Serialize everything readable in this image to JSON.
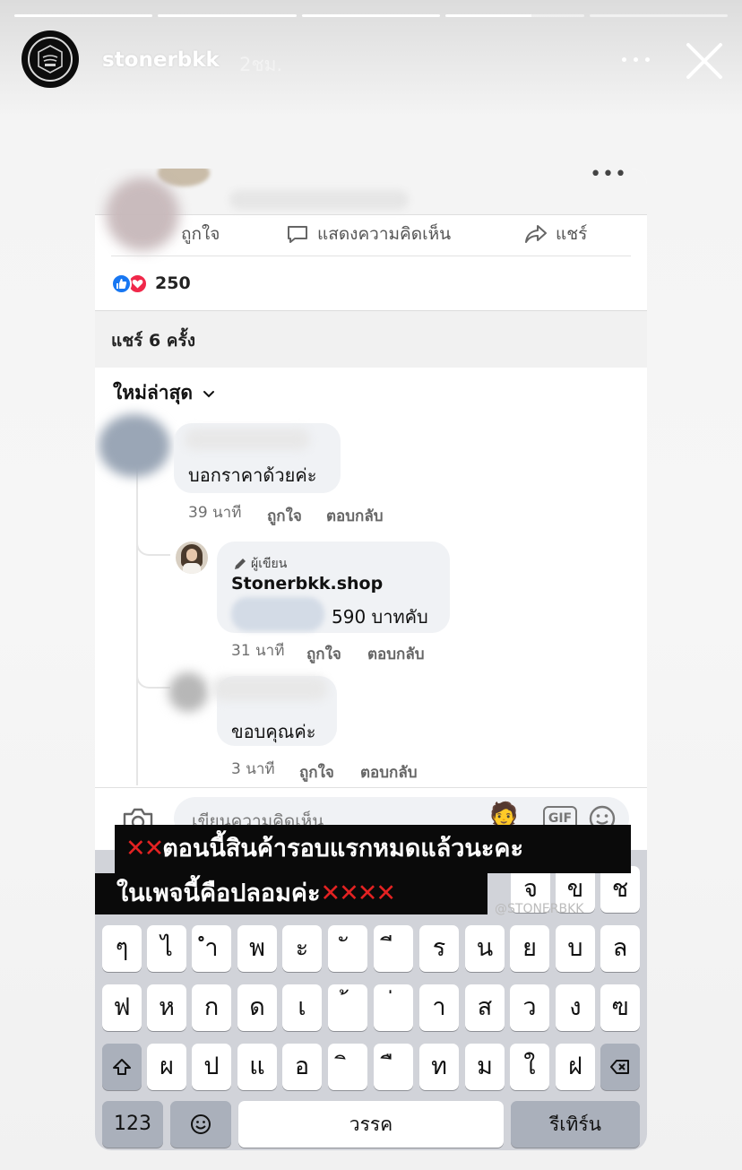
{
  "story": {
    "username": "stonerbkk",
    "time_ago": "2ชม.",
    "progress": [
      1,
      1,
      1,
      0.62,
      0
    ]
  },
  "post": {
    "action_like": "ถูกใจ",
    "action_comment": "แสดงความคิดเห็น",
    "action_share": "แชร์",
    "reaction_count": "250",
    "shares": "แชร์ 6 ครั้ง",
    "sort_label": "ใหม่ล่าสุด"
  },
  "comments": [
    {
      "text": "บอกราคาด้วยค่ะ",
      "time": "39 นาที",
      "like": "ถูกใจ",
      "reply": "ตอบกลับ"
    },
    {
      "badge": "ผู้เขียน",
      "author": "Stonerbkk.shop",
      "text": "590 บาทคับ",
      "time": "31 นาที",
      "like": "ถูกใจ",
      "reply": "ตอบกลับ"
    },
    {
      "text": "ขอบคุณค่ะ",
      "time": "3 นาที",
      "like": "ถูกใจ",
      "reply": "ตอบกลับ"
    }
  ],
  "composer": {
    "placeholder": "เขียนความคิดเห็น",
    "gif": "GIF"
  },
  "caption": {
    "line1_marks": "✕✕",
    "line1": "ตอนนี้สินค้ารอบแรกหมดแล้วนะคะ",
    "line2": "ในเพจนี้คือปลอมค่ะ",
    "line2_marks": "✕✕✕✕",
    "watermark": "@STONERBKK"
  },
  "keyboard": {
    "row0": [
      "จ",
      "ข",
      "ช"
    ],
    "row1": [
      "ๆ",
      "ไ",
      "ำ",
      "พ",
      "ะ",
      "ั",
      "ี",
      "ร",
      "น",
      "ย",
      "บ",
      "ล"
    ],
    "row2": [
      "ฟ",
      "ห",
      "ก",
      "ด",
      "เ",
      "้",
      "่",
      "า",
      "ส",
      "ว",
      "ง",
      "ฃ"
    ],
    "row3": [
      "ผ",
      "ป",
      "แ",
      "อ",
      "ิ",
      "ื",
      "ท",
      "ม",
      "ใ",
      "ฝ"
    ],
    "numbers": "123",
    "space": "วรรค",
    "enter": "รีเทิร์น"
  },
  "colors": {
    "facebook_blue": "#1877f2",
    "love_red": "#f0284a",
    "caption_x": "#e32222"
  }
}
